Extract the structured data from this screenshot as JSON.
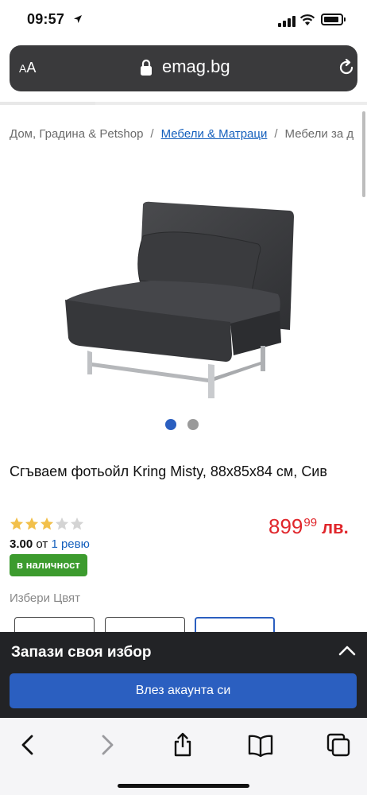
{
  "status_bar": {
    "time": "09:57"
  },
  "browser": {
    "text_size_label_small": "A",
    "text_size_label_large": "A",
    "url": "emag.bg"
  },
  "breadcrumb": {
    "items": [
      "Дом, Градина & Petshop",
      "Мебели & Матраци",
      "Мебели за д"
    ],
    "separator": "/"
  },
  "gallery": {
    "image_count": 2,
    "active_index": 0
  },
  "product": {
    "title": "Сгъваем фотьойл Kring Misty, 88x85x84 см, Сив",
    "rating_value": 3,
    "rating_max": 5,
    "rating_score": "3.00",
    "rating_from": "от",
    "reviews_text": "1 ревю",
    "stock_label": "в наличност",
    "price_main": "899",
    "price_cents": "99",
    "price_currency": "лв."
  },
  "color_picker": {
    "label": "Избери Цвят",
    "selected_index": 2
  },
  "save_banner": {
    "title": "Запази своя избор",
    "login_button": "Влез акаунта си"
  },
  "toolbar": {
    "icons": [
      "back-icon",
      "forward-icon",
      "share-icon",
      "bookmarks-icon",
      "tabs-icon"
    ]
  },
  "colors": {
    "accent_blue": "#2b5fc0",
    "link_blue": "#1560bd",
    "price_red": "#e0262b",
    "stock_green": "#3c9b2e",
    "star_gold": "#f2c04b",
    "banner_dark": "#222326"
  }
}
